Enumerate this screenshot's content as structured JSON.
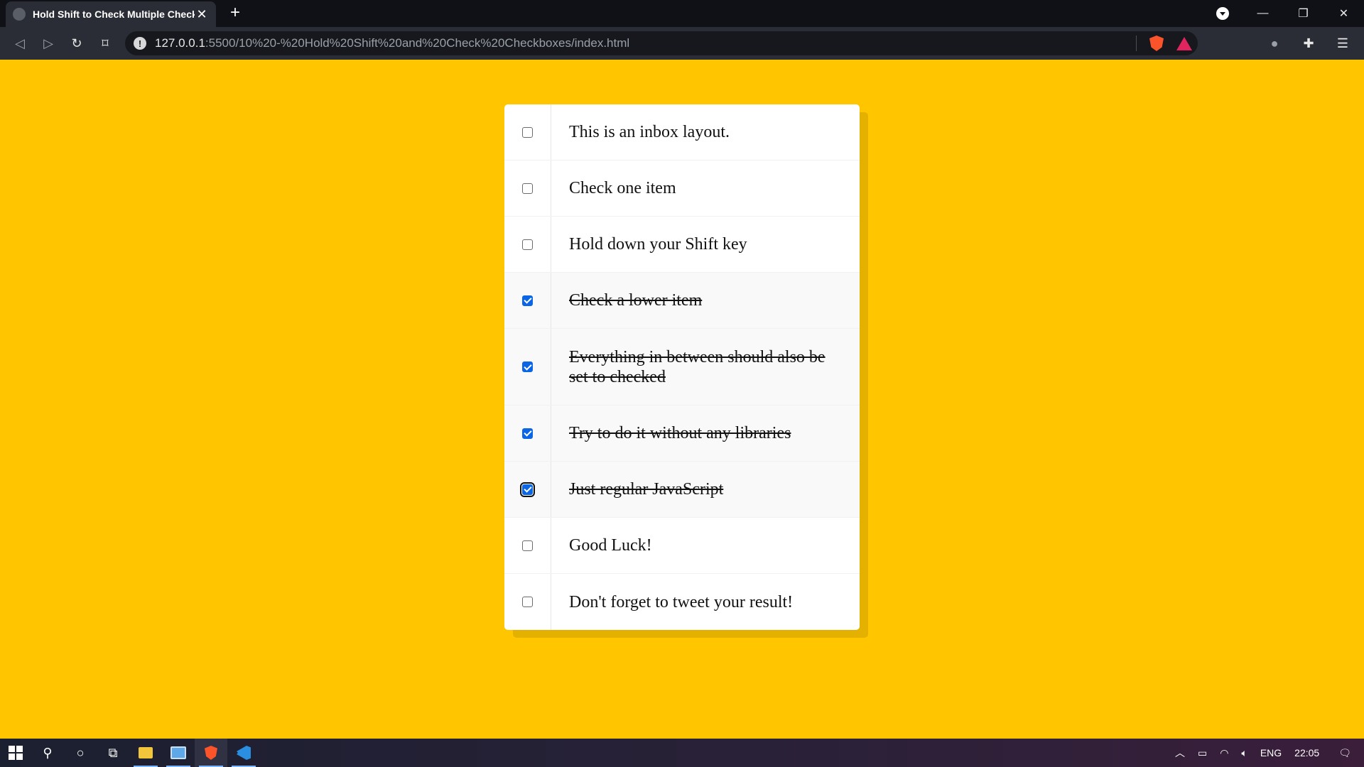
{
  "browser": {
    "tab_title": "Hold Shift to Check Multiple Checkboxes",
    "url_host": "127.0.0.1",
    "url_path": ":5500/10%20-%20Hold%20Shift%20and%20Check%20Checkboxes/index.html"
  },
  "inbox": {
    "items": [
      {
        "label": "This is an inbox layout.",
        "checked": false
      },
      {
        "label": "Check one item",
        "checked": false
      },
      {
        "label": "Hold down your Shift key",
        "checked": false
      },
      {
        "label": "Check a lower item",
        "checked": true
      },
      {
        "label": "Everything in between should also be set to checked",
        "checked": true
      },
      {
        "label": "Try to do it without any libraries",
        "checked": true
      },
      {
        "label": "Just regular JavaScript",
        "checked": true,
        "focused": true
      },
      {
        "label": "Good Luck!",
        "checked": false
      },
      {
        "label": "Don't forget to tweet your result!",
        "checked": false
      }
    ]
  },
  "taskbar": {
    "language": "ENG",
    "time": "22:05"
  },
  "colors": {
    "page_background": "#ffc600",
    "checkbox_accent": "#0a66e4"
  }
}
